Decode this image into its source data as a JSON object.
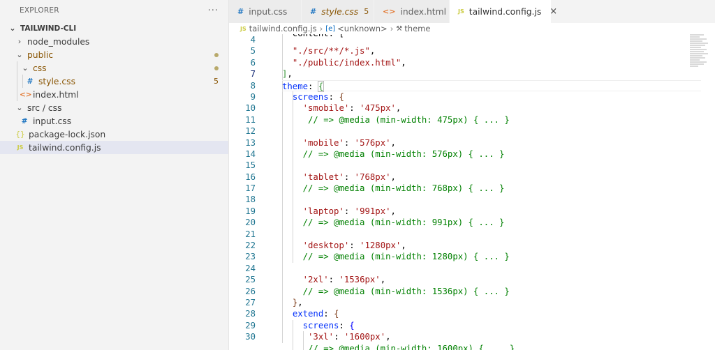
{
  "sidebar": {
    "title": "EXPLORER",
    "more": "···",
    "root": "TAILWIND-CLI",
    "items": [
      {
        "label": "node_modules",
        "chevron": "›",
        "icon": ""
      },
      {
        "label": "public",
        "chevron": "⌄",
        "icon": ""
      },
      {
        "label": "css",
        "chevron": "⌄",
        "icon": ""
      },
      {
        "label": "style.css",
        "chevron": "",
        "icon": "#",
        "badge": "5"
      },
      {
        "label": "index.html",
        "chevron": "",
        "icon": "<>"
      },
      {
        "label": "src / css",
        "chevron": "⌄",
        "icon": ""
      },
      {
        "label": "input.css",
        "chevron": "",
        "icon": "#"
      },
      {
        "label": "package-lock.json",
        "chevron": "",
        "icon": "{}"
      },
      {
        "label": "tailwind.config.js",
        "chevron": "",
        "icon": "JS"
      }
    ]
  },
  "tabs": [
    {
      "label": "input.css",
      "icon": "#"
    },
    {
      "label": "style.css",
      "icon": "#",
      "badge": "5"
    },
    {
      "label": "index.html",
      "icon": "<>"
    },
    {
      "label": "tailwind.config.js",
      "icon": "JS",
      "close": "×"
    }
  ],
  "breadcrumb": {
    "file_icon": "JS",
    "file": "tailwind.config.js",
    "sep": "›",
    "symbol1_icon": "[e]",
    "symbol1": "<unknown>",
    "symbol2_icon": "⚒",
    "symbol2": "theme"
  },
  "editor": {
    "line_numbers": [
      "4",
      "5",
      "6",
      "7",
      "8",
      "9",
      "10",
      "11",
      "12",
      "13",
      "14",
      "15",
      "16",
      "17",
      "18",
      "19",
      "20",
      "21",
      "22",
      "23",
      "24",
      "25",
      "26",
      "27",
      "28",
      "29",
      "30"
    ],
    "active_line": "7"
  },
  "colors": {
    "accent": "#0066bf",
    "keyword": "#0000ff",
    "string": "#a31515",
    "comment": "#008000",
    "modified": "#895503"
  }
}
